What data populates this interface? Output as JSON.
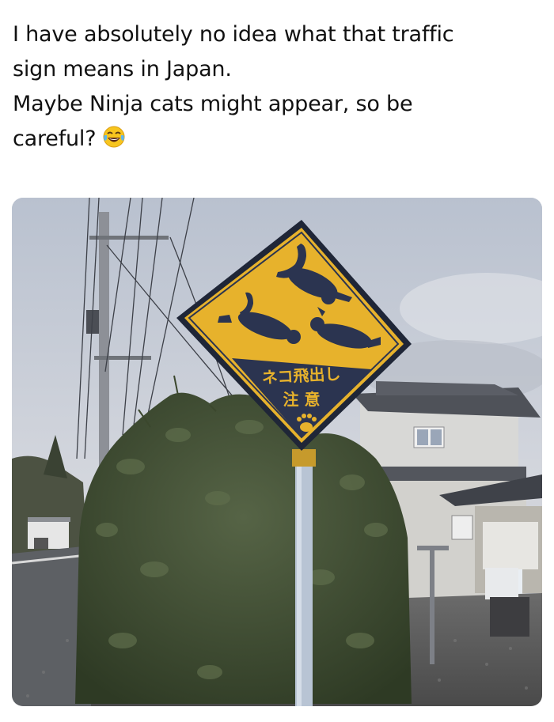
{
  "post": {
    "caption_lines": [
      "I have absolutely no idea what that traffic",
      "sign means in Japan.",
      "Maybe Ninja cats might appear, so be",
      "careful?"
    ],
    "emoji": "crying-laughing-emoji"
  },
  "photo": {
    "sign": {
      "line1": "ネコ飛出し",
      "line2": "注 意",
      "paw_icon": "paw-print-icon"
    },
    "colors": {
      "sign_yellow": "#e7b22c",
      "sign_navy": "#2b3450",
      "sky": "#c7ccd6",
      "hedge": "#3d4a2f"
    }
  }
}
